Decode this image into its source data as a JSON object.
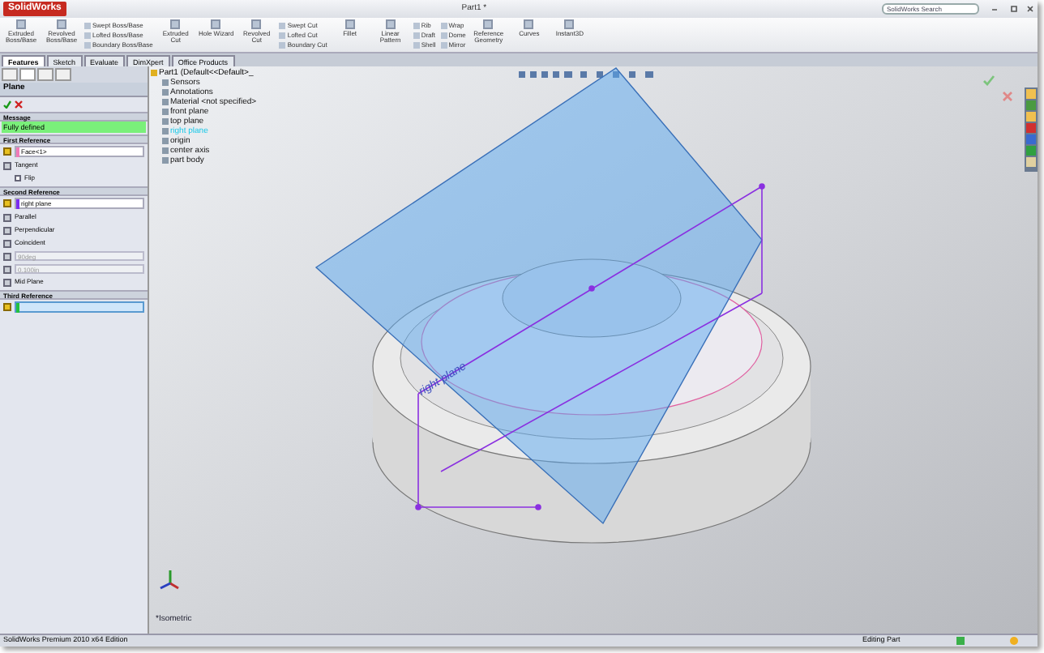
{
  "window": {
    "app_name": "SolidWorks",
    "title": "Part1 *",
    "search_placeholder": "SolidWorks Search"
  },
  "ribbon": [
    {
      "kind": "large",
      "label": "Extruded Boss/Base"
    },
    {
      "kind": "large",
      "label": "Revolved Boss/Base"
    },
    {
      "kind": "stack",
      "items": [
        "Swept Boss/Base",
        "Lofted Boss/Base",
        "Boundary Boss/Base"
      ]
    },
    {
      "kind": "large",
      "label": "Extruded Cut"
    },
    {
      "kind": "large",
      "label": "Hole Wizard"
    },
    {
      "kind": "large",
      "label": "Revolved Cut"
    },
    {
      "kind": "stack",
      "items": [
        "Swept Cut",
        "Lofted Cut",
        "Boundary Cut"
      ]
    },
    {
      "kind": "large",
      "label": "Fillet"
    },
    {
      "kind": "large",
      "label": "Linear Pattern"
    },
    {
      "kind": "stack",
      "items": [
        "Rib",
        "Draft",
        "Shell"
      ]
    },
    {
      "kind": "stack",
      "items": [
        "Wrap",
        "Dome",
        "Mirror"
      ]
    },
    {
      "kind": "large",
      "label": "Reference Geometry"
    },
    {
      "kind": "large",
      "label": "Curves"
    },
    {
      "kind": "large",
      "label": "Instant3D"
    }
  ],
  "tabs": [
    {
      "label": "Features",
      "selected": true
    },
    {
      "label": "Sketch",
      "selected": false
    },
    {
      "label": "Evaluate",
      "selected": false
    },
    {
      "label": "DimXpert",
      "selected": false
    },
    {
      "label": "Office Products",
      "selected": false
    }
  ],
  "property_manager": {
    "title": "Plane",
    "message_header": "Message",
    "message": "Fully defined",
    "sections": [
      {
        "title": "First Reference",
        "reference": {
          "value": "Face<1>",
          "color": "#f07ab8",
          "active": false
        },
        "options": [
          {
            "kind": "option",
            "label": "Tangent"
          },
          {
            "kind": "checkbox",
            "label": "Flip",
            "checked": false
          }
        ]
      },
      {
        "title": "Second Reference",
        "reference": {
          "value": "right plane",
          "color": "#7b2cf0",
          "active": false
        },
        "options": [
          {
            "kind": "option",
            "label": "Parallel"
          },
          {
            "kind": "option",
            "label": "Perpendicular"
          },
          {
            "kind": "option",
            "label": "Coincident"
          },
          {
            "kind": "spin",
            "value": "90deg",
            "disabled": true
          },
          {
            "kind": "spin",
            "value": "0.100in",
            "disabled": true
          },
          {
            "kind": "option",
            "label": "Mid Plane"
          }
        ]
      },
      {
        "title": "Third Reference",
        "reference": {
          "color": "#22c040",
          "active": true
        }
      }
    ]
  },
  "feature_tree": {
    "root": "Part1 (Default<<Default>_",
    "items": [
      {
        "label": "Sensors",
        "selected": false
      },
      {
        "label": "Annotations",
        "selected": false
      },
      {
        "label": "Material <not specified>",
        "selected": false
      },
      {
        "label": "front plane",
        "selected": false
      },
      {
        "label": "top plane",
        "selected": false
      },
      {
        "label": "right plane",
        "selected": true
      },
      {
        "label": "origin",
        "selected": false
      },
      {
        "label": "center axis",
        "selected": false
      },
      {
        "label": "part body",
        "selected": false
      }
    ]
  },
  "viewport": {
    "plane_label": "right plane",
    "view_label": "*Isometric"
  },
  "status_bar": {
    "edition": "SolidWorks Premium 2010 x64 Edition",
    "mode": "Editing Part"
  }
}
